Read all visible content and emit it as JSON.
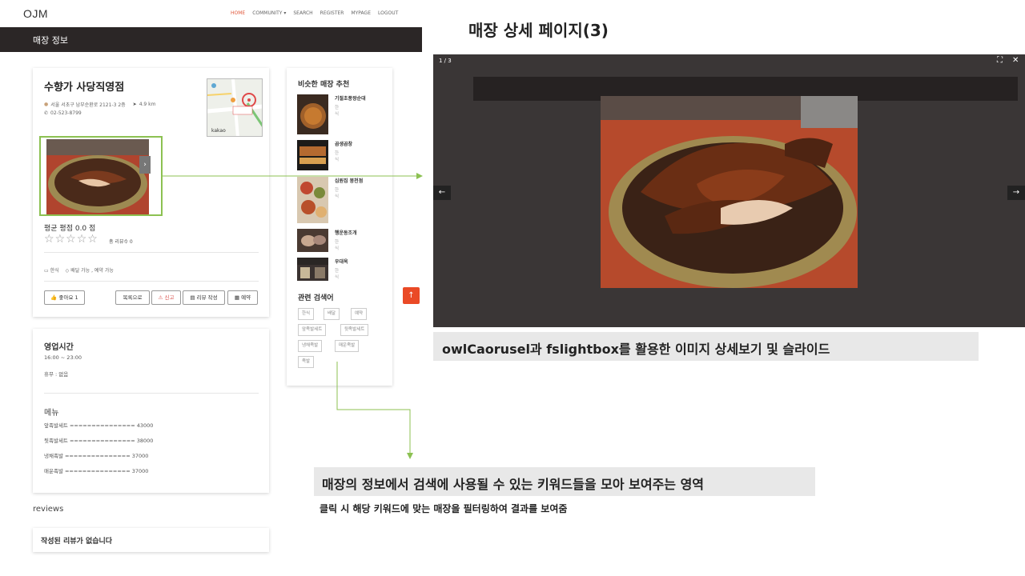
{
  "site": {
    "logo": "OJM",
    "nav": [
      "HOME",
      "COMMUNITY ▾",
      "SEARCH",
      "REGISTER",
      "MYPAGE",
      "LOGOUT"
    ],
    "header_title": "매장 정보",
    "store": {
      "name": "수향가 사당직영점",
      "address": "서울 서초구 남부순환로 2121-3 2층",
      "distance": "4.9 km",
      "phone": "02-523-8799",
      "map_brand": "kakao",
      "rating_text": "평균 평점 0.0 점",
      "review_count": "총 리뷰수 0",
      "category": "한식",
      "options": "배달 가능 , 예약 가능",
      "like_label": "좋아요 1",
      "back_label": "목록으로",
      "report_label": "신고",
      "write_review_label": "리뷰 작성",
      "reserve_label": "예약"
    },
    "hours": {
      "title": "영업시간",
      "time": "16:00 ~ 23:00",
      "holiday": "휴무 : 없음",
      "menu_title": "메뉴",
      "menu_items": [
        "앞족발세트 =============== 43000",
        "뒷족발세트 =============== 38000",
        "냉채족발 =============== 37000",
        "매운족발 =============== 37000"
      ]
    },
    "reviews_label": "reviews",
    "no_reviews": "작성된 리뷰가 없습니다",
    "similar": {
      "title": "비슷한 매장 추천",
      "items": [
        {
          "name": "기절초풍왕순대",
          "category": "한식"
        },
        {
          "name": "곱생곱창",
          "category": "한식"
        },
        {
          "name": "십원집 봉천점",
          "category": "한식"
        },
        {
          "name": "행운동조개",
          "category": "한식"
        },
        {
          "name": "우대옥",
          "category": "한식"
        }
      ]
    },
    "keywords": {
      "title": "관련 검색어",
      "items": [
        "한식",
        "배달",
        "예약",
        "앞족발세트",
        "뒷족발세트",
        "냉채족발",
        "매운족발",
        "족발"
      ]
    },
    "top_icon": "arrow-up-icon"
  },
  "slide": {
    "title": "매장 상세 페이지(3)",
    "lightbox_counter": "1 / 3",
    "caption_lightbox": "owlCaorusel과 fslightbox를 활용한 이미지 상세보기 및 슬라이드",
    "caption_keywords": "매장의 정보에서 검색에 사용될 수 있는 키워드들을 모아 보여주는 영역",
    "caption_keywords_sub": "클릭 시 해당 키워드에 맞는 매장을 필터링하여 결과를 보여줌",
    "colors": {
      "highlight": "#8cc152",
      "accent": "#ea4a26",
      "header": "#2b2626"
    }
  }
}
